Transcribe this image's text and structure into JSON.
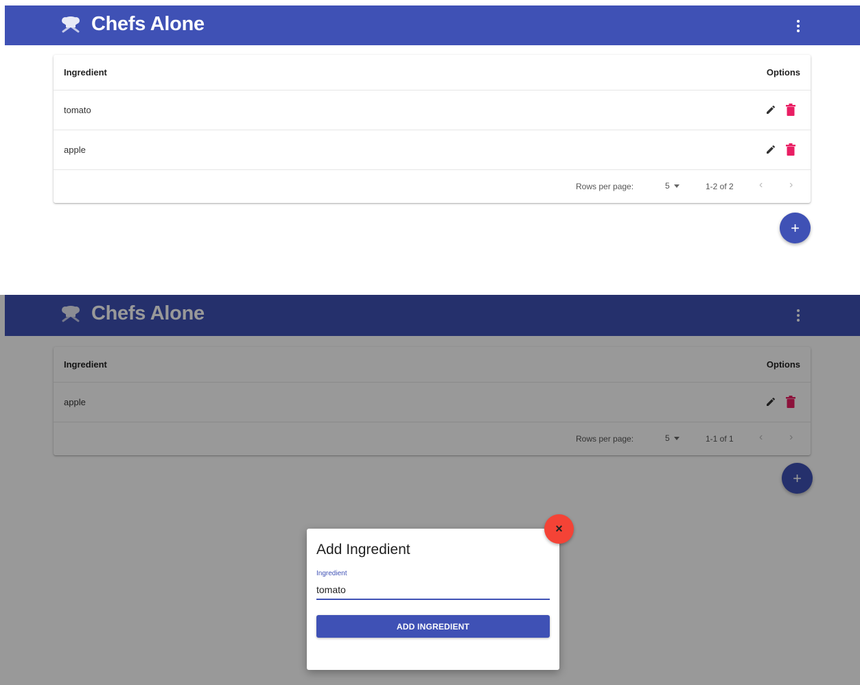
{
  "colors": {
    "primary": "#3f51b5",
    "delete": "#e91e63",
    "close": "#f44336"
  },
  "icons": {
    "logo": "chef-hat-icon",
    "menu": "more-vert-icon",
    "edit": "pencil-icon",
    "delete": "trash-icon",
    "add": "plus-icon",
    "close": "close-icon"
  },
  "panel1": {
    "app_title": "Chefs Alone",
    "table": {
      "header_ingredient": "Ingredient",
      "header_options": "Options",
      "rows": [
        {
          "name": "tomato"
        },
        {
          "name": "apple"
        }
      ],
      "pager": {
        "rows_per_page_label": "Rows per page:",
        "rows_per_page": "5",
        "range": "1-2 of 2",
        "prev": "‹",
        "next": "›"
      }
    },
    "fab": "+"
  },
  "panel2": {
    "app_title": "Chefs Alone",
    "table": {
      "header_ingredient": "Ingredient",
      "header_options": "Options",
      "rows": [
        {
          "name": "apple"
        }
      ],
      "pager": {
        "rows_per_page_label": "Rows per page:",
        "rows_per_page": "5",
        "range": "1-1 of 1",
        "prev": "‹",
        "next": "›"
      }
    },
    "fab": "+",
    "dialog": {
      "title": "Add Ingredient",
      "field_label": "Ingredient",
      "field_value": "tomato",
      "submit_label": "ADD INGREDIENT",
      "close": "×"
    }
  }
}
